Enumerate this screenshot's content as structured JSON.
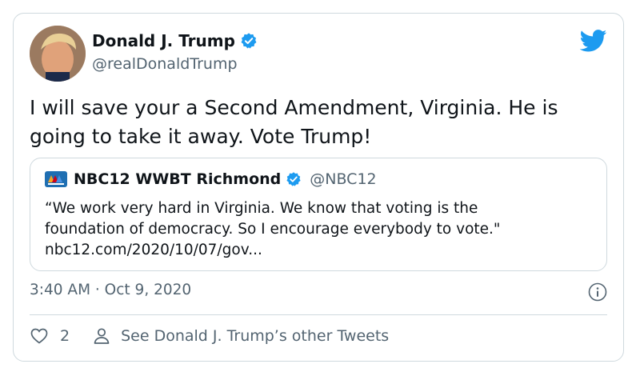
{
  "tweet": {
    "author": {
      "name": "Donald J. Trump",
      "handle": "@realDonaldTrump",
      "verified": true
    },
    "text": "I will save your a Second Amendment, Virginia. He is going to take it away. Vote Trump!",
    "timestamp": "3:40 AM · Oct 9, 2020"
  },
  "quoted": {
    "name": "NBC12 WWBT Richmond",
    "handle": "@NBC12",
    "verified": true,
    "text_line1": "“We work very hard in Virginia. We know that voting is the",
    "text_line2": "foundation of democracy. So I encourage everybody to vote.\"",
    "text_line3": "nbc12.com/2020/10/07/gov..."
  },
  "actions": {
    "like_count": "2",
    "other_tweets_label": "See Donald J. Trump’s other Tweets"
  },
  "icons": {
    "brand": "twitter-bird-icon",
    "verified": "verified-badge-icon",
    "info": "info-icon",
    "like": "heart-icon",
    "profile": "person-icon"
  },
  "colors": {
    "twitter_blue": "#1d9bf0",
    "text_primary": "#0f1419",
    "text_secondary": "#536471",
    "border": "#cfd9de"
  }
}
